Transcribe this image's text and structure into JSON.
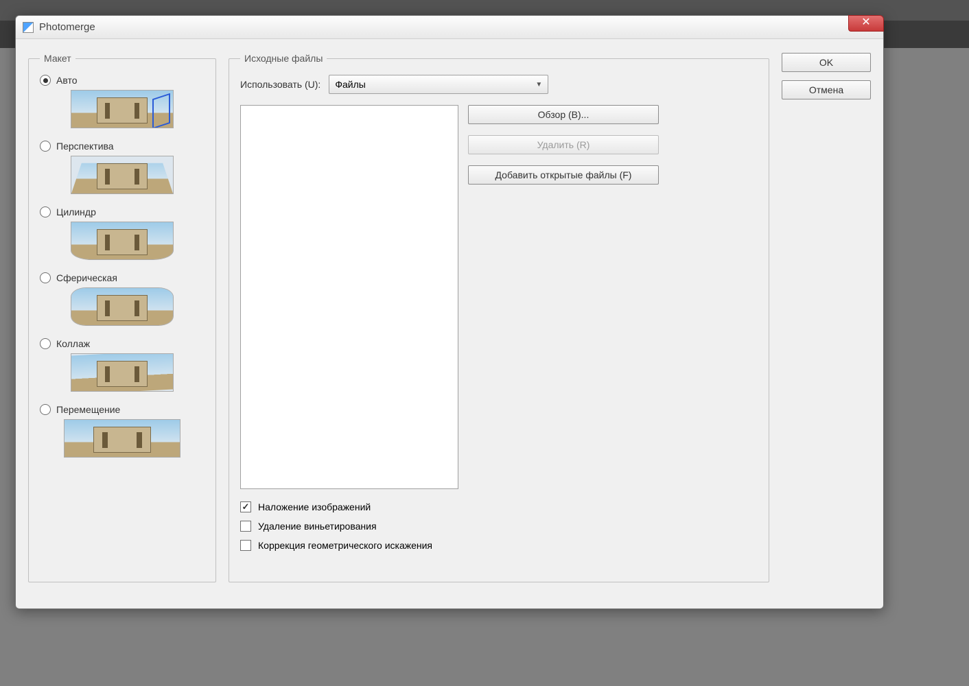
{
  "window": {
    "title": "Photomerge"
  },
  "layout": {
    "legend": "Макет",
    "options": [
      {
        "key": "auto",
        "label": "Авто",
        "checked": true
      },
      {
        "key": "persp",
        "label": "Перспектива",
        "checked": false
      },
      {
        "key": "cyl",
        "label": "Цилиндр",
        "checked": false
      },
      {
        "key": "sph",
        "label": "Сферическая",
        "checked": false
      },
      {
        "key": "coll",
        "label": "Коллаж",
        "checked": false
      },
      {
        "key": "repo",
        "label": "Перемещение",
        "checked": false
      }
    ]
  },
  "source": {
    "legend": "Исходные файлы",
    "use_label": "Использовать (U):",
    "use_value": "Файлы",
    "browse": "Обзор (B)...",
    "remove": "Удалить (R)",
    "add_open": "Добавить открытые файлы (F)"
  },
  "checks": {
    "blend": {
      "label": "Наложение изображений",
      "checked": true
    },
    "vignette": {
      "label": "Удаление виньетирования",
      "checked": false
    },
    "geo": {
      "label": "Коррекция геометрического искажения",
      "checked": false
    }
  },
  "actions": {
    "ok": "OK",
    "cancel": "Отмена"
  }
}
